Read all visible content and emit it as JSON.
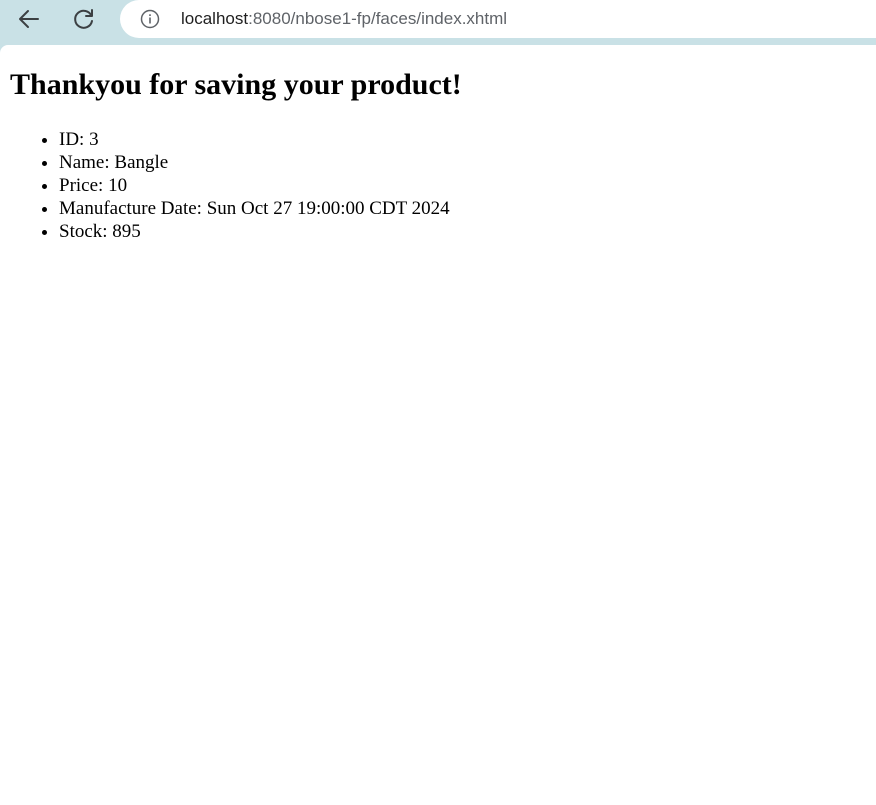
{
  "browser": {
    "url_host": "localhost",
    "url_rest": ":8080/nbose1-fp/faces/index.xhtml",
    "back_icon": "arrow-left-icon",
    "reload_icon": "reload-icon",
    "info_icon": "info-icon"
  },
  "page": {
    "title": "Thankyou for saving your product!",
    "items": [
      "ID: 3",
      "Name: Bangle",
      "Price: 10",
      "Manufacture Date: Sun Oct 27 19:00:00 CDT 2024",
      "Stock: 895"
    ]
  }
}
